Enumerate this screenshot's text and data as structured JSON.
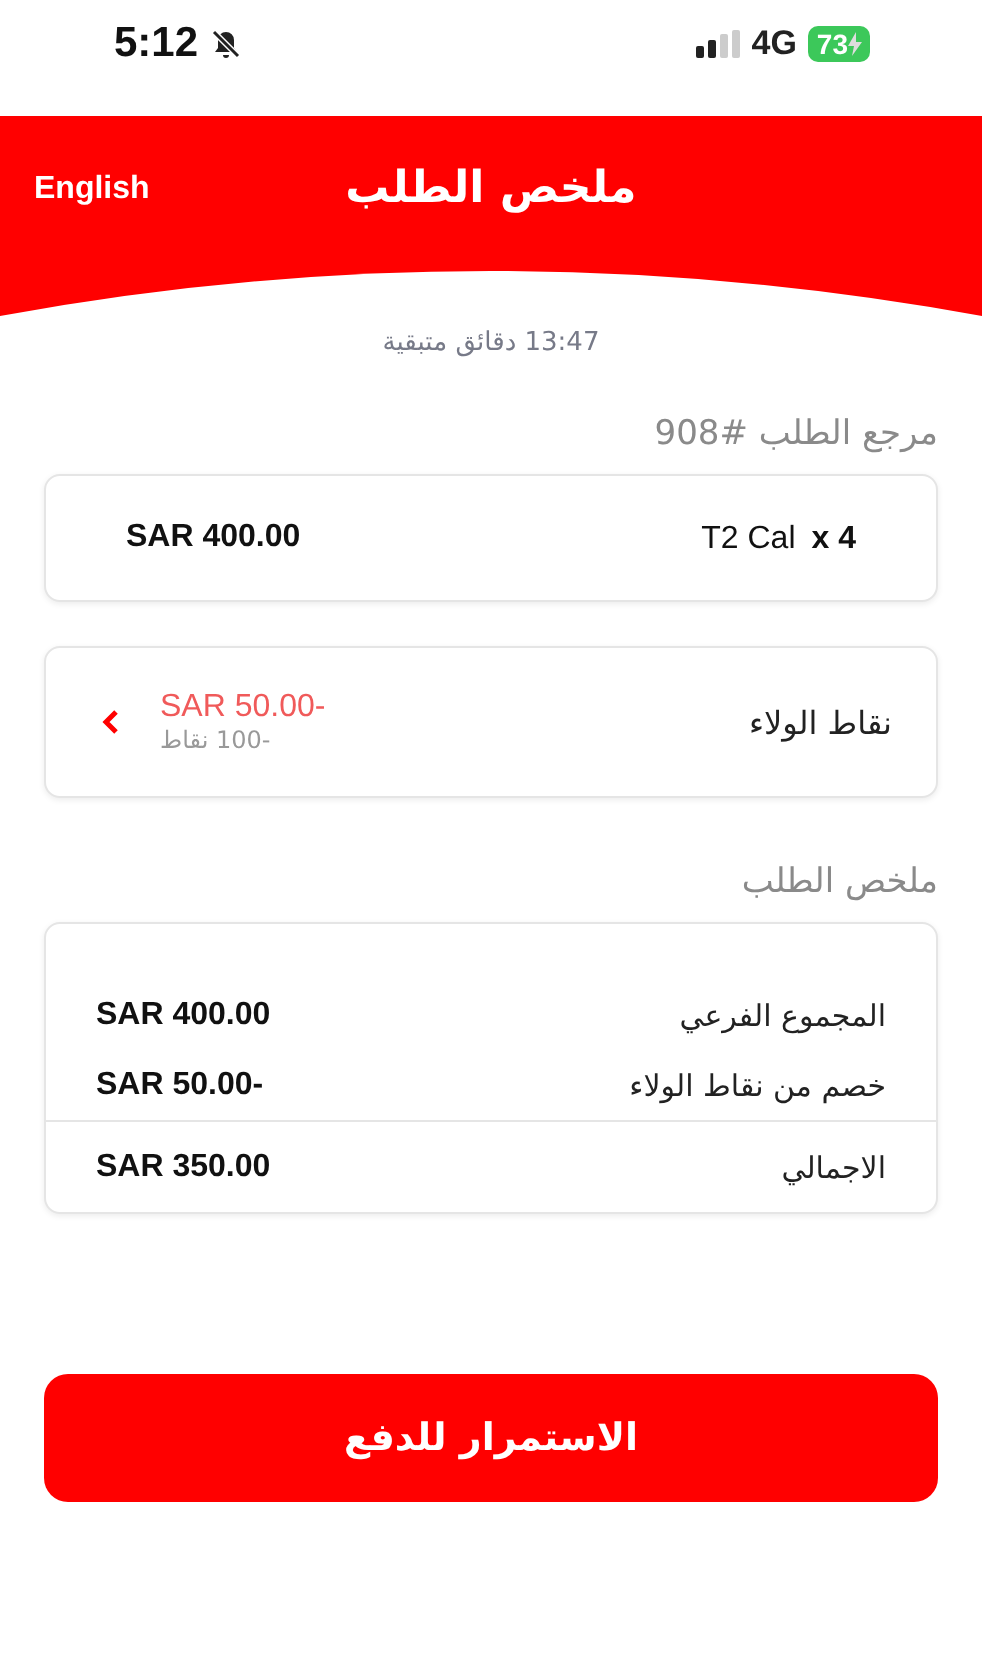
{
  "status_bar": {
    "time": "5:12",
    "network": "4G",
    "battery": "73"
  },
  "header": {
    "title": "ملخص الطلب",
    "language_link": "English"
  },
  "timer": "13:47 دقائق متبقية",
  "order_reference": "مرجع الطلب #908",
  "item": {
    "name": "T2 Cal",
    "quantity": "x 4",
    "price": "SAR 400.00"
  },
  "loyalty": {
    "label": "نقاط الولاء",
    "amount": "SAR 50.00-",
    "points": "-100 نقاط"
  },
  "summary": {
    "title": "ملخص الطلب",
    "rows": [
      {
        "label": "المجموع الفرعي",
        "value": "SAR 400.00",
        "total": false
      },
      {
        "label": "خصم من نقاط الولاء",
        "value": "SAR 50.00-",
        "total": false
      },
      {
        "label": "الاجمالي",
        "value": "SAR 350.00",
        "total": true
      }
    ]
  },
  "continue_button": "الاستمرار للدفع"
}
